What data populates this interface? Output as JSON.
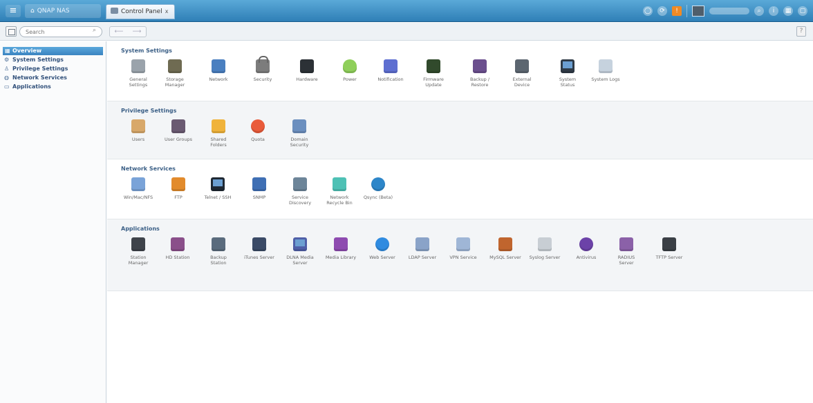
{
  "topbar": {
    "menu_icon": "hamburger-icon",
    "home_tab_label": "QNAP NAS",
    "active_tab_label": "Control Panel",
    "close_label": "x"
  },
  "toolbar": {
    "search_placeholder": "Search",
    "back_label": "⟵",
    "forward_label": "⟶",
    "help_label": "?"
  },
  "sidebar": {
    "items": [
      {
        "label": "Overview",
        "icon": "grid-icon",
        "active": true
      },
      {
        "label": "System Settings",
        "icon": "gear-icon",
        "active": false
      },
      {
        "label": "Privilege Settings",
        "icon": "user-icon",
        "active": false
      },
      {
        "label": "Network Services",
        "icon": "globe-icon",
        "active": false
      },
      {
        "label": "Applications",
        "icon": "app-icon",
        "active": false
      }
    ]
  },
  "sections": [
    {
      "title": "System Settings",
      "items": [
        {
          "label": "General\nSettings",
          "icon": "general-settings-icon",
          "color": "#9aa3ab"
        },
        {
          "label": "Storage\nManager",
          "icon": "storage-icon",
          "color": "#6f6b52"
        },
        {
          "label": "Network",
          "icon": "network-icon",
          "color": "#4a7fc0"
        },
        {
          "label": "Security",
          "icon": "lock-icon",
          "color": "#7c7c7c"
        },
        {
          "label": "Hardware",
          "icon": "hardware-icon",
          "color": "#2c3136"
        },
        {
          "label": "Power",
          "icon": "bulb-icon",
          "color": "#8fcf5a"
        },
        {
          "label": "Notification",
          "icon": "notification-icon",
          "color": "#5e6fd1"
        },
        {
          "label": "Firmware\nUpdate",
          "icon": "firmware-icon",
          "color": "#314a2c"
        },
        {
          "label": "Backup /\nRestore",
          "icon": "backup-icon",
          "color": "#6b4f8e"
        },
        {
          "label": "External\nDevice",
          "icon": "external-device-icon",
          "color": "#5c6670"
        },
        {
          "label": "System\nStatus",
          "icon": "monitor-icon",
          "color": "#2f3a46"
        },
        {
          "label": "System Logs",
          "icon": "logs-icon",
          "color": "#c6d2de"
        }
      ]
    },
    {
      "title": "Privilege Settings",
      "items": [
        {
          "label": "Users",
          "icon": "user-icon",
          "color": "#d8a86a"
        },
        {
          "label": "User Groups",
          "icon": "user-group-icon",
          "color": "#6a5a72"
        },
        {
          "label": "Shared\nFolders",
          "icon": "folder-icon",
          "color": "#f0b33b"
        },
        {
          "label": "Quota",
          "icon": "quota-icon",
          "color": "#e95b3a"
        },
        {
          "label": "Domain\nSecurity",
          "icon": "domain-security-icon",
          "color": "#6b8fbf"
        }
      ]
    },
    {
      "title": "Network Services",
      "items": [
        {
          "label": "Win/Mac/NFS",
          "icon": "win-mac-nfs-icon",
          "color": "#7aa3d8"
        },
        {
          "label": "FTP",
          "icon": "ftp-icon",
          "color": "#e28b2c"
        },
        {
          "label": "Telnet / SSH",
          "icon": "terminal-icon",
          "color": "#1f2833"
        },
        {
          "label": "SNMP",
          "icon": "snmp-icon",
          "color": "#3f6fb4"
        },
        {
          "label": "Service\nDiscovery",
          "icon": "service-discovery-icon",
          "color": "#6d8599"
        },
        {
          "label": "Network\nRecycle Bin",
          "icon": "recycle-bin-icon",
          "color": "#4ec1b5"
        },
        {
          "label": "Qsync (Beta)",
          "icon": "qsync-icon",
          "color": "#2d86c9"
        }
      ]
    },
    {
      "title": "Applications",
      "items": [
        {
          "label": "Station\nManager",
          "icon": "station-manager-icon",
          "color": "#3e434a"
        },
        {
          "label": "HD Station",
          "icon": "hd-station-icon",
          "color": "#8a4f8a"
        },
        {
          "label": "Backup\nStation",
          "icon": "backup-station-icon",
          "color": "#5a6b7d"
        },
        {
          "label": "iTunes Server",
          "icon": "itunes-icon",
          "color": "#3a4a66"
        },
        {
          "label": "DLNA Media\nServer",
          "icon": "dlna-icon",
          "color": "#4f5fa8"
        },
        {
          "label": "Media Library",
          "icon": "media-library-icon",
          "color": "#8e4bb0"
        },
        {
          "label": "Web Server",
          "icon": "globe-icon",
          "color": "#2f8be0"
        },
        {
          "label": "LDAP Server",
          "icon": "ldap-icon",
          "color": "#8aa3c8"
        },
        {
          "label": "VPN Service",
          "icon": "vpn-icon",
          "color": "#9fb6d6"
        },
        {
          "label": "MySQL Server",
          "icon": "mysql-icon",
          "color": "#c0652e"
        },
        {
          "label": "Syslog Server",
          "icon": "syslog-icon",
          "color": "#c8ced4"
        },
        {
          "label": "Antivirus",
          "icon": "antivirus-icon",
          "color": "#6c42a8"
        },
        {
          "label": "RADIUS\nServer",
          "icon": "radius-icon",
          "color": "#8b61a8"
        },
        {
          "label": "TFTP Server",
          "icon": "tftp-icon",
          "color": "#3a3f45"
        }
      ]
    }
  ]
}
